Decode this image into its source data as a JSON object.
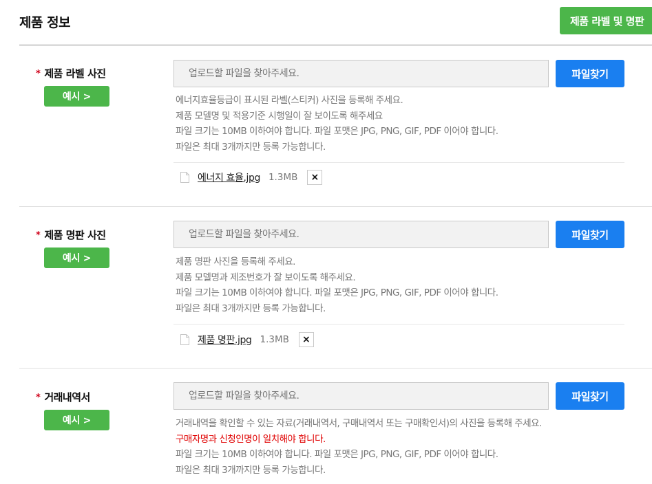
{
  "header": {
    "title": "제품 정보",
    "top_button": "제품 라벨 및 명판"
  },
  "sections": [
    {
      "label": "제품 라벨 사진",
      "required_mark": "*",
      "example_button": "예시 >",
      "input_placeholder": "업로드할 파일을 찾아주세요.",
      "find_button": "파일찾기",
      "help": [
        "에너지효율등급이 표시된 라벨(스티커) 사진을 등록해 주세요.",
        "제품 모델명 및 적용기준 시행일이 잘 보이도록 해주세요",
        "파일 크기는 10MB 이하여야 합니다. 파일 포맷은 JPG, PNG, GIF, PDF 이어야 합니다.",
        "파일은 최대 3개까지만 등록 가능합니다."
      ],
      "file": {
        "name": "에너지 효율.jpg",
        "size": "1.3MB",
        "delete_label": "×"
      }
    },
    {
      "label": "제품 명판 사진",
      "required_mark": "*",
      "example_button": "예시 >",
      "input_placeholder": "업로드할 파일을 찾아주세요.",
      "find_button": "파일찾기",
      "help": [
        "제품 명판 사진을 등록해 주세요.",
        "제품 모델명과 제조번호가 잘 보이도록 해주세요.",
        "파일 크기는 10MB 이하여야 합니다. 파일 포맷은 JPG, PNG, GIF, PDF 이어야 합니다.",
        "파일은 최대 3개까지만 등록 가능합니다."
      ],
      "file": {
        "name": "제품 명판.jpg",
        "size": "1.3MB",
        "delete_label": "×"
      }
    },
    {
      "label": "거래내역서",
      "required_mark": "*",
      "example_button": "예시 >",
      "input_placeholder": "업로드할 파일을 찾아주세요.",
      "find_button": "파일찾기",
      "help": [
        "거래내역을 확인할 수 있는 자료(거래내역서, 구매내역서 또는 구매확인서)의 사진을 등록해 주세요.",
        "구매자명과 신청인명이 일치해야 합니다.",
        "파일 크기는 10MB 이하여야 합니다. 파일 포맷은 JPG, PNG, GIF, PDF 이어야 합니다.",
        "파일은 최대 3개까지만 등록 가능합니다."
      ]
    }
  ],
  "colors": {
    "green_button": "#4cb64a",
    "blue_button": "#1a7ff0",
    "required_star": "#d0021b",
    "warning_text": "#e00000"
  },
  "icons": {
    "file": "file-icon",
    "delete": "close-icon"
  }
}
